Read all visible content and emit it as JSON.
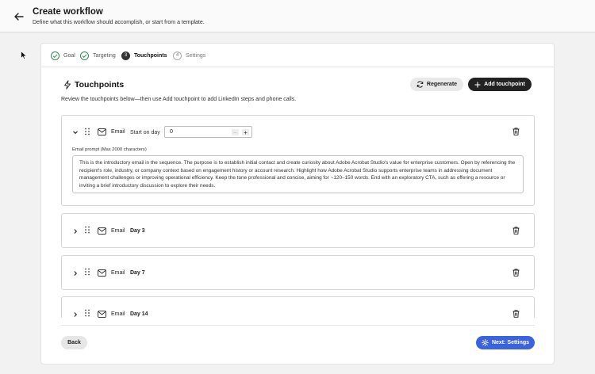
{
  "header": {
    "title": "Create workflow",
    "subtitle": "Define what this workflow should accomplish, or start from a template."
  },
  "steps": [
    {
      "number": "1",
      "label": "Goal",
      "state": "done"
    },
    {
      "number": "2",
      "label": "Targeting",
      "state": "done"
    },
    {
      "number": "3",
      "label": "Touchpoints",
      "state": "active"
    },
    {
      "number": "4",
      "label": "Settings",
      "state": "todo"
    }
  ],
  "section": {
    "title": "Touchpoints",
    "description": "Review the touchpoints below—then use Add touchpoint to add LinkedIn steps and phone calls.",
    "regenerate_label": "Regenerate",
    "add_label": "Add touchpoint"
  },
  "touchpoints": [
    {
      "type": "Email",
      "start_label": "Start on day",
      "start_value": "0",
      "prompt_label": "Email prompt (Max 2000 characters)",
      "prompt": "This is the introductory email in the sequence. The purpose is to establish initial contact and create curiosity about Adobe Acrobat Studio's value for enterprise customers. Open by referencing the recipient's role, industry, or company context based on engagement history or account research. Highlight how Adobe Acrobat Studio supports enterprise teams in addressing document management challenges or improving operational efficiency. Keep the tone professional and concise, aiming for ~120–150 words. End with an exploratory CTA, such as offering a resource or inviting a brief introductory discussion to explore their needs."
    },
    {
      "type": "Email",
      "day": "Day 3"
    },
    {
      "type": "Email",
      "day": "Day 7"
    },
    {
      "type": "Email",
      "day": "Day 14"
    }
  ],
  "footer": {
    "back_label": "Back",
    "next_label": "Next: Settings"
  },
  "colors": {
    "primary": "#3b63e0",
    "success": "#2e8b57",
    "dark": "#222222"
  }
}
